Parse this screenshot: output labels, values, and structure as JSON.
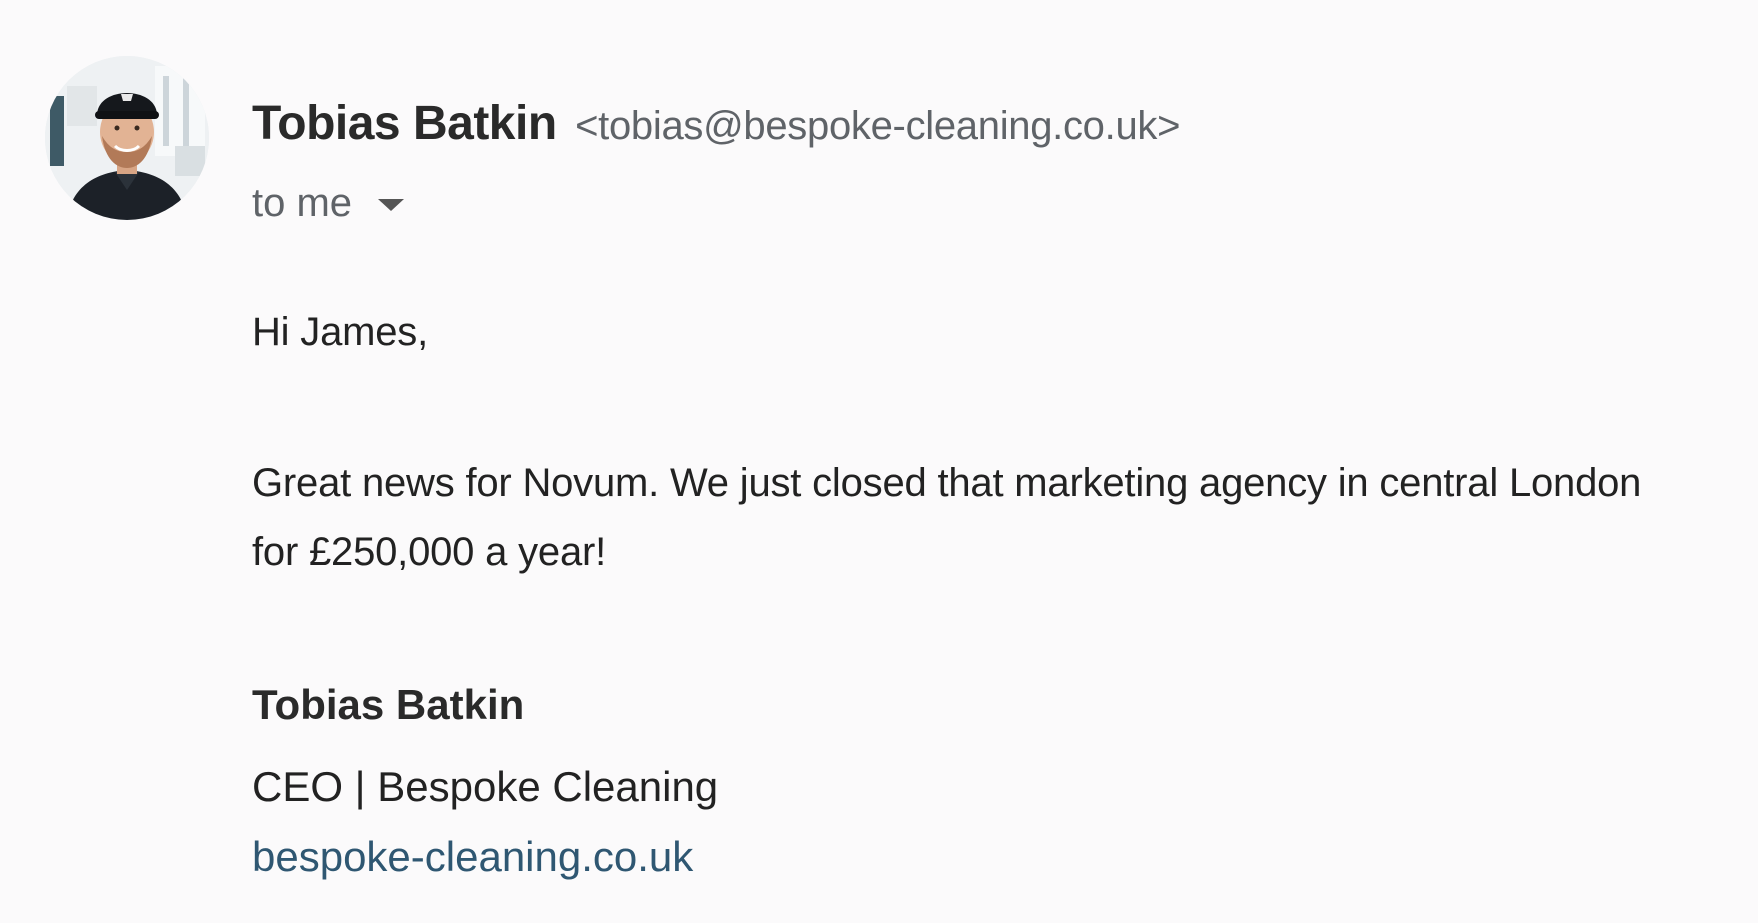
{
  "sender": {
    "name": "Tobias Batkin",
    "email": "<tobias@bespoke-cleaning.co.uk>"
  },
  "recipients": {
    "label": "to me"
  },
  "message": {
    "greeting": "Hi James,",
    "body": "Great news for Novum. We just closed that marketing agency in central London for £250,000 a year!"
  },
  "signature": {
    "name": "Tobias Batkin",
    "title": "CEO | Bespoke Cleaning",
    "website": "bespoke-cleaning.co.uk"
  },
  "icons": {
    "avatar": "sender-avatar-photo",
    "chevron": "chevron-down-icon"
  },
  "colors": {
    "background": "#fbfafb",
    "link": "#2f5772",
    "secondary_text": "#5f6368"
  }
}
